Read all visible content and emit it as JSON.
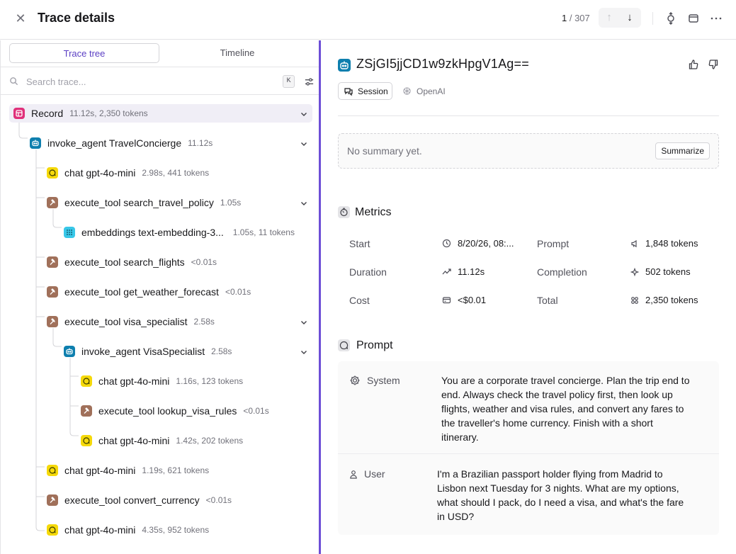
{
  "header": {
    "title": "Trace details",
    "counter_current": "1",
    "counter_total": " / 307"
  },
  "left": {
    "tabs": [
      {
        "label": "Trace tree",
        "active": true
      },
      {
        "label": "Timeline",
        "active": false
      }
    ],
    "search": {
      "placeholder": "Search trace...",
      "shortcut": "K"
    },
    "tree": [
      {
        "type": "record",
        "name": "Record",
        "meta": "11.12s, 2,350 tokens",
        "expanded": true
      },
      {
        "type": "agent",
        "name": "invoke_agent TravelConcierge",
        "meta": "11.12s",
        "expanded": true
      },
      {
        "type": "chat",
        "name": "chat gpt-4o-mini",
        "meta": "2.98s, 441 tokens"
      },
      {
        "type": "tool",
        "name": "execute_tool search_travel_policy",
        "meta": "1.05s",
        "expanded": true
      },
      {
        "type": "embedding",
        "name": "embeddings text-embedding-3...",
        "meta": "1.05s, 11 tokens"
      },
      {
        "type": "tool",
        "name": "execute_tool search_flights",
        "meta": "<0.01s"
      },
      {
        "type": "tool",
        "name": "execute_tool get_weather_forecast",
        "meta": "<0.01s"
      },
      {
        "type": "tool",
        "name": "execute_tool visa_specialist",
        "meta": "2.58s",
        "expanded": true
      },
      {
        "type": "agent",
        "name": "invoke_agent VisaSpecialist",
        "meta": "2.58s",
        "expanded": true
      },
      {
        "type": "chat",
        "name": "chat gpt-4o-mini",
        "meta": "1.16s, 123 tokens"
      },
      {
        "type": "tool",
        "name": "execute_tool lookup_visa_rules",
        "meta": "<0.01s"
      },
      {
        "type": "chat",
        "name": "chat gpt-4o-mini",
        "meta": "1.42s, 202 tokens"
      },
      {
        "type": "chat",
        "name": "chat gpt-4o-mini",
        "meta": "1.19s, 621 tokens"
      },
      {
        "type": "tool",
        "name": "execute_tool convert_currency",
        "meta": "<0.01s"
      },
      {
        "type": "chat",
        "name": "chat gpt-4o-mini",
        "meta": "4.35s, 952 tokens"
      }
    ]
  },
  "detail": {
    "trace_id": "ZSjGI5jjCD1w9zkHpgV1Ag==",
    "chips": {
      "session": "Session",
      "provider": "OpenAI"
    },
    "summary": {
      "empty_text": "No summary yet.",
      "button": "Summarize"
    },
    "metrics": {
      "title": "Metrics",
      "start_label": "Start",
      "start_value": "8/20/26, 08:...",
      "duration_label": "Duration",
      "duration_value": "11.12s",
      "cost_label": "Cost",
      "cost_value": "<$0.01",
      "prompt_label": "Prompt",
      "prompt_value": "1,848 tokens",
      "completion_label": "Completion",
      "completion_value": "502 tokens",
      "total_label": "Total",
      "total_value": "2,350 tokens"
    },
    "prompt": {
      "title": "Prompt",
      "messages": [
        {
          "role": "System",
          "lines": [
            "You are a corporate travel concierge. Plan the trip end to",
            "end. Always check the travel policy first, then look up",
            "flights, weather and visa rules, and convert any fares to",
            "the traveller's home currency. Finish with a short",
            "itinerary."
          ]
        },
        {
          "role": "User",
          "lines": [
            "I'm a Brazilian passport holder flying from Madrid to",
            "Lisbon next Tuesday for 3 nights. What are my options,",
            "what should I pack, do I need a visa, and what's the fare",
            "in USD?"
          ]
        }
      ]
    }
  },
  "colors": {
    "accent": "#6d4fd6",
    "record_icon": "#e0307a",
    "agent_icon": "#0e7fae",
    "chat_icon": "#f5d90a",
    "tool_icon": "#a0705a",
    "embedding_icon": "#38c7e8"
  }
}
